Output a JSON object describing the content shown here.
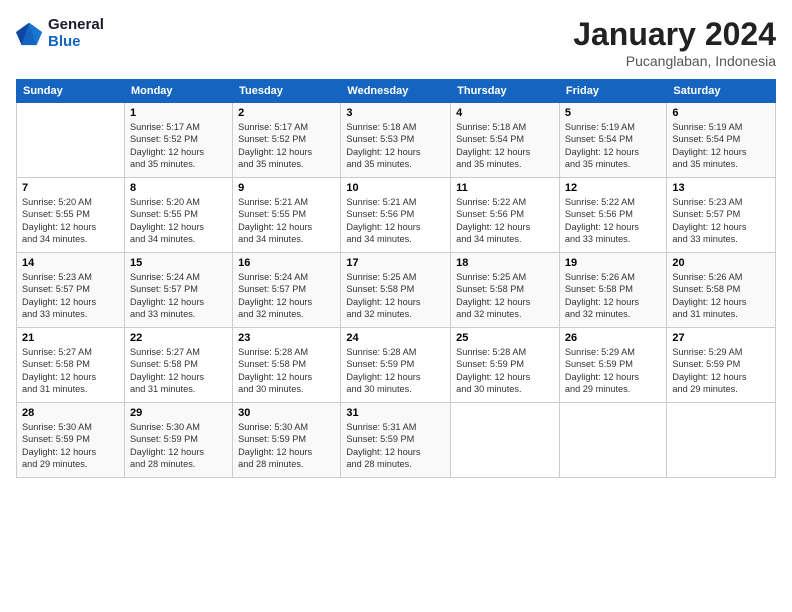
{
  "logo": {
    "line1": "General",
    "line2": "Blue"
  },
  "title": "January 2024",
  "subtitle": "Pucanglaban, Indonesia",
  "days_header": [
    "Sunday",
    "Monday",
    "Tuesday",
    "Wednesday",
    "Thursday",
    "Friday",
    "Saturday"
  ],
  "weeks": [
    [
      {
        "num": "",
        "info": ""
      },
      {
        "num": "1",
        "info": "Sunrise: 5:17 AM\nSunset: 5:52 PM\nDaylight: 12 hours\nand 35 minutes."
      },
      {
        "num": "2",
        "info": "Sunrise: 5:17 AM\nSunset: 5:52 PM\nDaylight: 12 hours\nand 35 minutes."
      },
      {
        "num": "3",
        "info": "Sunrise: 5:18 AM\nSunset: 5:53 PM\nDaylight: 12 hours\nand 35 minutes."
      },
      {
        "num": "4",
        "info": "Sunrise: 5:18 AM\nSunset: 5:54 PM\nDaylight: 12 hours\nand 35 minutes."
      },
      {
        "num": "5",
        "info": "Sunrise: 5:19 AM\nSunset: 5:54 PM\nDaylight: 12 hours\nand 35 minutes."
      },
      {
        "num": "6",
        "info": "Sunrise: 5:19 AM\nSunset: 5:54 PM\nDaylight: 12 hours\nand 35 minutes."
      }
    ],
    [
      {
        "num": "7",
        "info": "Sunrise: 5:20 AM\nSunset: 5:55 PM\nDaylight: 12 hours\nand 34 minutes."
      },
      {
        "num": "8",
        "info": "Sunrise: 5:20 AM\nSunset: 5:55 PM\nDaylight: 12 hours\nand 34 minutes."
      },
      {
        "num": "9",
        "info": "Sunrise: 5:21 AM\nSunset: 5:55 PM\nDaylight: 12 hours\nand 34 minutes."
      },
      {
        "num": "10",
        "info": "Sunrise: 5:21 AM\nSunset: 5:56 PM\nDaylight: 12 hours\nand 34 minutes."
      },
      {
        "num": "11",
        "info": "Sunrise: 5:22 AM\nSunset: 5:56 PM\nDaylight: 12 hours\nand 34 minutes."
      },
      {
        "num": "12",
        "info": "Sunrise: 5:22 AM\nSunset: 5:56 PM\nDaylight: 12 hours\nand 33 minutes."
      },
      {
        "num": "13",
        "info": "Sunrise: 5:23 AM\nSunset: 5:57 PM\nDaylight: 12 hours\nand 33 minutes."
      }
    ],
    [
      {
        "num": "14",
        "info": "Sunrise: 5:23 AM\nSunset: 5:57 PM\nDaylight: 12 hours\nand 33 minutes."
      },
      {
        "num": "15",
        "info": "Sunrise: 5:24 AM\nSunset: 5:57 PM\nDaylight: 12 hours\nand 33 minutes."
      },
      {
        "num": "16",
        "info": "Sunrise: 5:24 AM\nSunset: 5:57 PM\nDaylight: 12 hours\nand 32 minutes."
      },
      {
        "num": "17",
        "info": "Sunrise: 5:25 AM\nSunset: 5:58 PM\nDaylight: 12 hours\nand 32 minutes."
      },
      {
        "num": "18",
        "info": "Sunrise: 5:25 AM\nSunset: 5:58 PM\nDaylight: 12 hours\nand 32 minutes."
      },
      {
        "num": "19",
        "info": "Sunrise: 5:26 AM\nSunset: 5:58 PM\nDaylight: 12 hours\nand 32 minutes."
      },
      {
        "num": "20",
        "info": "Sunrise: 5:26 AM\nSunset: 5:58 PM\nDaylight: 12 hours\nand 31 minutes."
      }
    ],
    [
      {
        "num": "21",
        "info": "Sunrise: 5:27 AM\nSunset: 5:58 PM\nDaylight: 12 hours\nand 31 minutes."
      },
      {
        "num": "22",
        "info": "Sunrise: 5:27 AM\nSunset: 5:58 PM\nDaylight: 12 hours\nand 31 minutes."
      },
      {
        "num": "23",
        "info": "Sunrise: 5:28 AM\nSunset: 5:58 PM\nDaylight: 12 hours\nand 30 minutes."
      },
      {
        "num": "24",
        "info": "Sunrise: 5:28 AM\nSunset: 5:59 PM\nDaylight: 12 hours\nand 30 minutes."
      },
      {
        "num": "25",
        "info": "Sunrise: 5:28 AM\nSunset: 5:59 PM\nDaylight: 12 hours\nand 30 minutes."
      },
      {
        "num": "26",
        "info": "Sunrise: 5:29 AM\nSunset: 5:59 PM\nDaylight: 12 hours\nand 29 minutes."
      },
      {
        "num": "27",
        "info": "Sunrise: 5:29 AM\nSunset: 5:59 PM\nDaylight: 12 hours\nand 29 minutes."
      }
    ],
    [
      {
        "num": "28",
        "info": "Sunrise: 5:30 AM\nSunset: 5:59 PM\nDaylight: 12 hours\nand 29 minutes."
      },
      {
        "num": "29",
        "info": "Sunrise: 5:30 AM\nSunset: 5:59 PM\nDaylight: 12 hours\nand 28 minutes."
      },
      {
        "num": "30",
        "info": "Sunrise: 5:30 AM\nSunset: 5:59 PM\nDaylight: 12 hours\nand 28 minutes."
      },
      {
        "num": "31",
        "info": "Sunrise: 5:31 AM\nSunset: 5:59 PM\nDaylight: 12 hours\nand 28 minutes."
      },
      {
        "num": "",
        "info": ""
      },
      {
        "num": "",
        "info": ""
      },
      {
        "num": "",
        "info": ""
      }
    ]
  ]
}
